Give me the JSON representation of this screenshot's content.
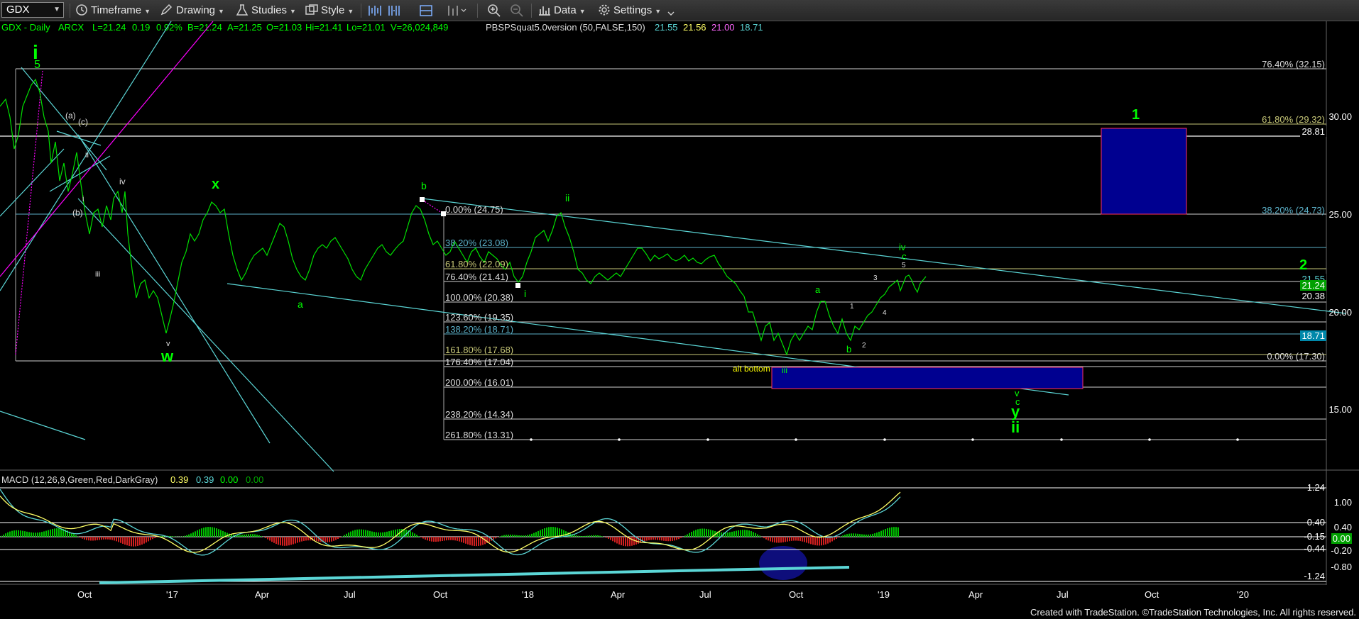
{
  "toolbar": {
    "symbol": "GDX",
    "timeframe_label": "Timeframe",
    "drawing_label": "Drawing",
    "studies_label": "Studies",
    "style_label": "Style",
    "data_label": "Data",
    "settings_label": "Settings"
  },
  "header": {
    "title": "GDX - Daily",
    "exchange": "ARCX",
    "last": "L=21.24",
    "change": "0.19",
    "change_pct": "0.92%",
    "bid": "B=21.24",
    "ask": "A=21.25",
    "open": "O=21.03",
    "high": "Hi=21.41",
    "low": "Lo=21.01",
    "volume": "V=26,024,849",
    "study": "PBSPSquat5.0version (50,FALSE,150)",
    "study_vals": [
      "21.55",
      "21.56",
      "21.00",
      "18.71"
    ],
    "colors": {
      "title": "#00ff00",
      "study1": "#5bd6d6",
      "study2": "#ffff66",
      "study3": "#ff66ff",
      "study4": "#5bd6d6"
    }
  },
  "price_axis": {
    "ticks": [
      "30.00",
      "25.00",
      "20.00",
      "15.00"
    ],
    "badges": [
      {
        "text": "28.81",
        "color": "#ffffff",
        "bg": "#000000"
      },
      {
        "text": "21.55",
        "color": "#5bd6d6",
        "bg": "#000000"
      },
      {
        "text": "21.24",
        "color": "#ffffff",
        "bg": "#00a000"
      },
      {
        "text": "20.38",
        "color": "#ffffff",
        "bg": "#000000"
      },
      {
        "text": "18.71",
        "color": "#ffffff",
        "bg": "#0088aa"
      }
    ]
  },
  "time_axis": [
    "Oct",
    "'17",
    "Apr",
    "Jul",
    "Oct",
    "'18",
    "Apr",
    "Jul",
    "Oct",
    "'19",
    "Apr",
    "Jul",
    "Oct",
    "'20"
  ],
  "fib_levels": [
    {
      "text": "76.40% (32.15)",
      "color": "#dddddd"
    },
    {
      "text": "61.80% (29.32)",
      "color": "#c8c878"
    },
    {
      "text": "38.20% (24.73)",
      "color": "#5bb0c8"
    },
    {
      "text": "0.00% (17.30)",
      "color": "#dddddd"
    },
    {
      "text": "0.00% (24.75)",
      "color": "#dddddd"
    },
    {
      "text": "38.20% (23.08)",
      "color": "#5bb0c8"
    },
    {
      "text": "61.80% (22.09)",
      "color": "#c8c878"
    },
    {
      "text": "76.40% (21.41)",
      "color": "#dddddd"
    },
    {
      "text": "100.00% (20.38)",
      "color": "#dddddd"
    },
    {
      "text": "123.60% (19.35)",
      "color": "#dddddd"
    },
    {
      "text": "138.20% (18.71)",
      "color": "#5bb0c8"
    },
    {
      "text": "161.80% (17.68)",
      "color": "#c8c878"
    },
    {
      "text": "176.40% (17.04)",
      "color": "#dddddd"
    },
    {
      "text": "200.00% (16.01)",
      "color": "#dddddd"
    },
    {
      "text": "238.20% (14.34)",
      "color": "#dddddd"
    },
    {
      "text": "261.80% (13.31)",
      "color": "#dddddd"
    }
  ],
  "wave_labels": [
    {
      "text": "i",
      "color": "#00ff00"
    },
    {
      "text": "5",
      "color": "#00ff00"
    },
    {
      "text": "(a)",
      "color": "#dddddd"
    },
    {
      "text": "(c)",
      "color": "#dddddd"
    },
    {
      "text": "ii",
      "color": "#dddddd"
    },
    {
      "text": "i",
      "color": "#dddddd"
    },
    {
      "text": "(b)",
      "color": "#dddddd"
    },
    {
      "text": "iv",
      "color": "#dddddd"
    },
    {
      "text": "iii",
      "color": "#dddddd"
    },
    {
      "text": "v",
      "color": "#dddddd"
    },
    {
      "text": "w",
      "color": "#00ff00"
    },
    {
      "text": "x",
      "color": "#00ff00"
    },
    {
      "text": "a",
      "color": "#00ff00"
    },
    {
      "text": "b",
      "color": "#00ff00"
    },
    {
      "text": "i",
      "color": "#00ff00"
    },
    {
      "text": "ii",
      "color": "#00ff00"
    },
    {
      "text": "iii",
      "color": "#00ff00"
    },
    {
      "text": "alt bottom",
      "color": "#ffff00"
    },
    {
      "text": "a",
      "color": "#00ff00"
    },
    {
      "text": "b",
      "color": "#00ff00"
    },
    {
      "text": "1",
      "color": "#dddddd"
    },
    {
      "text": "2",
      "color": "#dddddd"
    },
    {
      "text": "3",
      "color": "#dddddd"
    },
    {
      "text": "4",
      "color": "#dddddd"
    },
    {
      "text": "5",
      "color": "#dddddd"
    },
    {
      "text": "iv",
      "color": "#00ff00"
    },
    {
      "text": "c",
      "color": "#00ff00"
    },
    {
      "text": "v",
      "color": "#00ff00"
    },
    {
      "text": "c",
      "color": "#00ff00"
    },
    {
      "text": "y",
      "color": "#00ff00"
    },
    {
      "text": "ii",
      "color": "#00ff00"
    },
    {
      "text": "1",
      "color": "#00ff00"
    },
    {
      "text": "2",
      "color": "#00ff00"
    }
  ],
  "macd": {
    "title": "MACD (12,26,9,Green,Red,DarkGray)",
    "values": [
      {
        "text": "0.39",
        "color": "#ffff66"
      },
      {
        "text": "0.39",
        "color": "#5bd6d6"
      },
      {
        "text": "0.00",
        "color": "#00ff00"
      },
      {
        "text": "0.00",
        "color": "#00aa00"
      }
    ],
    "axis_ticks": [
      "1.24",
      "1.00",
      "0.40",
      "0.40",
      "-0.15",
      "0.00",
      "-0.44",
      "-0.20",
      "-0.80",
      "-1.24"
    ]
  },
  "colors": {
    "price_up": "#00ff00",
    "price_down": "#ffffff",
    "channel": "#5bd6d6",
    "magenta": "#ff00ff",
    "target_box": "#000090",
    "target_border": "#ff3060",
    "macd_line": "#5bd6d6",
    "signal_line": "#ffff66"
  },
  "footer": "Created with TradeStation. ©TradeStation Technologies, Inc. All rights reserved."
}
